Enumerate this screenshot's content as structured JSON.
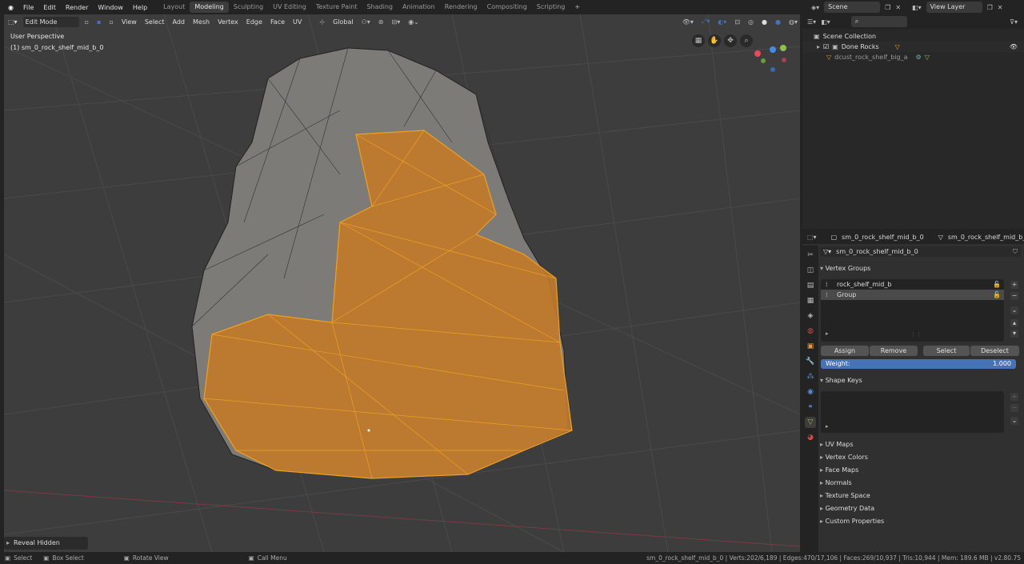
{
  "topbar": {
    "menu": [
      "File",
      "Edit",
      "Render",
      "Window",
      "Help"
    ],
    "workspaces": [
      "Layout",
      "Modeling",
      "Sculpting",
      "UV Editing",
      "Texture Paint",
      "Shading",
      "Animation",
      "Rendering",
      "Compositing",
      "Scripting"
    ],
    "active_workspace": "Modeling",
    "scene_label": "Scene",
    "view_layer_label": "View Layer"
  },
  "viewport": {
    "mode": "Edit Mode",
    "menus": [
      "View",
      "Select",
      "Add",
      "Mesh",
      "Vertex",
      "Edge",
      "Face",
      "UV"
    ],
    "transform_orientation": "Global",
    "perspective_label": "User Perspective",
    "object_label": "(1) sm_0_rock_shelf_mid_b_0",
    "gizmo_axes": [
      "X",
      "Y",
      "Z"
    ],
    "last_operator": "Reveal Hidden",
    "colors": {
      "grid_bg": "#3d3d3d",
      "selection": "#f0a020",
      "x_axis": "#e64a5b",
      "y_axis": "#8bc34a",
      "z_axis": "#3f8ceb"
    }
  },
  "outliner": {
    "root": "Scene Collection",
    "collection": "Done Rocks",
    "object": "dcust_rock_shelf_big_a"
  },
  "properties": {
    "object_name": "sm_0_rock_shelf_mid_b_0",
    "data_name": "sm_0_rock_shelf_mid_b_0",
    "mesh_name": "sm_0_rock_shelf_mid_b_0",
    "vertex_groups_title": "Vertex Groups",
    "vertex_groups": [
      "rock_shelf_mid_b",
      "Group"
    ],
    "selected_group": "Group",
    "buttons": [
      "Assign",
      "Remove",
      "Select",
      "Deselect"
    ],
    "weight_label": "Weight:",
    "weight_value": "1.000",
    "shape_keys_title": "Shape Keys",
    "collapsed_panels": [
      "UV Maps",
      "Vertex Colors",
      "Face Maps",
      "Normals",
      "Texture Space",
      "Geometry Data",
      "Custom Properties"
    ]
  },
  "statusbar": {
    "select": "Select",
    "box_select": "Box Select",
    "rotate_view": "Rotate View",
    "call_menu": "Call Menu",
    "stats": "sm_0_rock_shelf_mid_b_0 | Verts:202/6,189 | Edges:470/17,106 | Faces:269/10,937 | Tris:10,944 | Mem: 189.6 MB | v2.80.75"
  }
}
